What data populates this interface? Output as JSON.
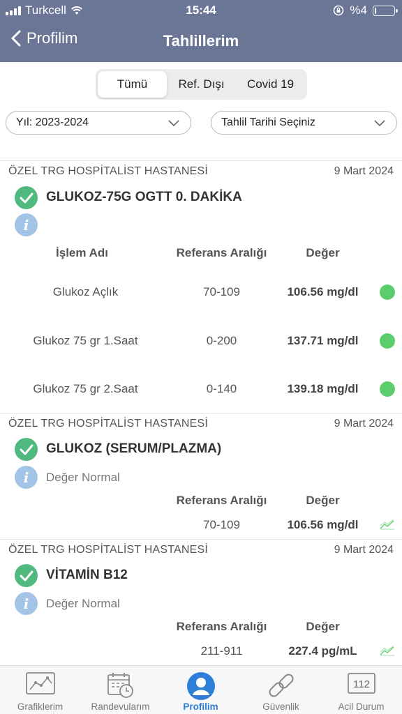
{
  "status": {
    "carrier": "Turkcell",
    "time": "15:44",
    "battery": "%4",
    "battery_level": 0.04
  },
  "nav": {
    "back_label": "Profilim",
    "title": "Tahlillerim"
  },
  "segments": [
    "Tümü",
    "Ref. Dışı",
    "Covid 19"
  ],
  "filters": {
    "year": "Yıl: 2023-2024",
    "date": "Tahlil Tarihi Seçiniz"
  },
  "columns": {
    "name": "İşlem Adı",
    "range": "Referans Aralığı",
    "value": "Değer"
  },
  "cards": [
    {
      "hospital": "ÖZEL TRG HOSPİTALİST HASTANESİ",
      "date": "9 Mart 2024",
      "title": "GLUKOZ-75G OGTT 0. DAKİKA",
      "rows": [
        {
          "name": "Glukoz Açlık",
          "range": "70-109",
          "value": "106.56 mg/dl"
        },
        {
          "name": "Glukoz 75 gr 1.Saat",
          "range": "0-200",
          "value": "137.71 mg/dl"
        },
        {
          "name": "Glukoz 75 gr 2.Saat",
          "range": "0-140",
          "value": "139.18 mg/dl"
        }
      ]
    },
    {
      "hospital": "ÖZEL TRG HOSPİTALİST HASTANESİ",
      "date": "9 Mart 2024",
      "title": "GLUKOZ (SERUM/PLAZMA)",
      "info": "Değer Normal",
      "range": "70-109",
      "value": "106.56 mg/dl"
    },
    {
      "hospital": "ÖZEL TRG HOSPİTALİST HASTANESİ",
      "date": "9 Mart 2024",
      "title": "VİTAMİN B12",
      "info": "Değer Normal",
      "range": "211-911",
      "value": "227.4 pg/mL"
    }
  ],
  "tabs": [
    "Grafiklerim",
    "Randevularım",
    "Profilim",
    "Güvenlik",
    "Acil Durum"
  ],
  "emergency_number": "112",
  "colors": {
    "header": "#6b7596",
    "check": "#4fb97f",
    "info": "#a3c4e6",
    "status_dot": "#5ccd6c",
    "active_tab": "#2f7fd8"
  }
}
